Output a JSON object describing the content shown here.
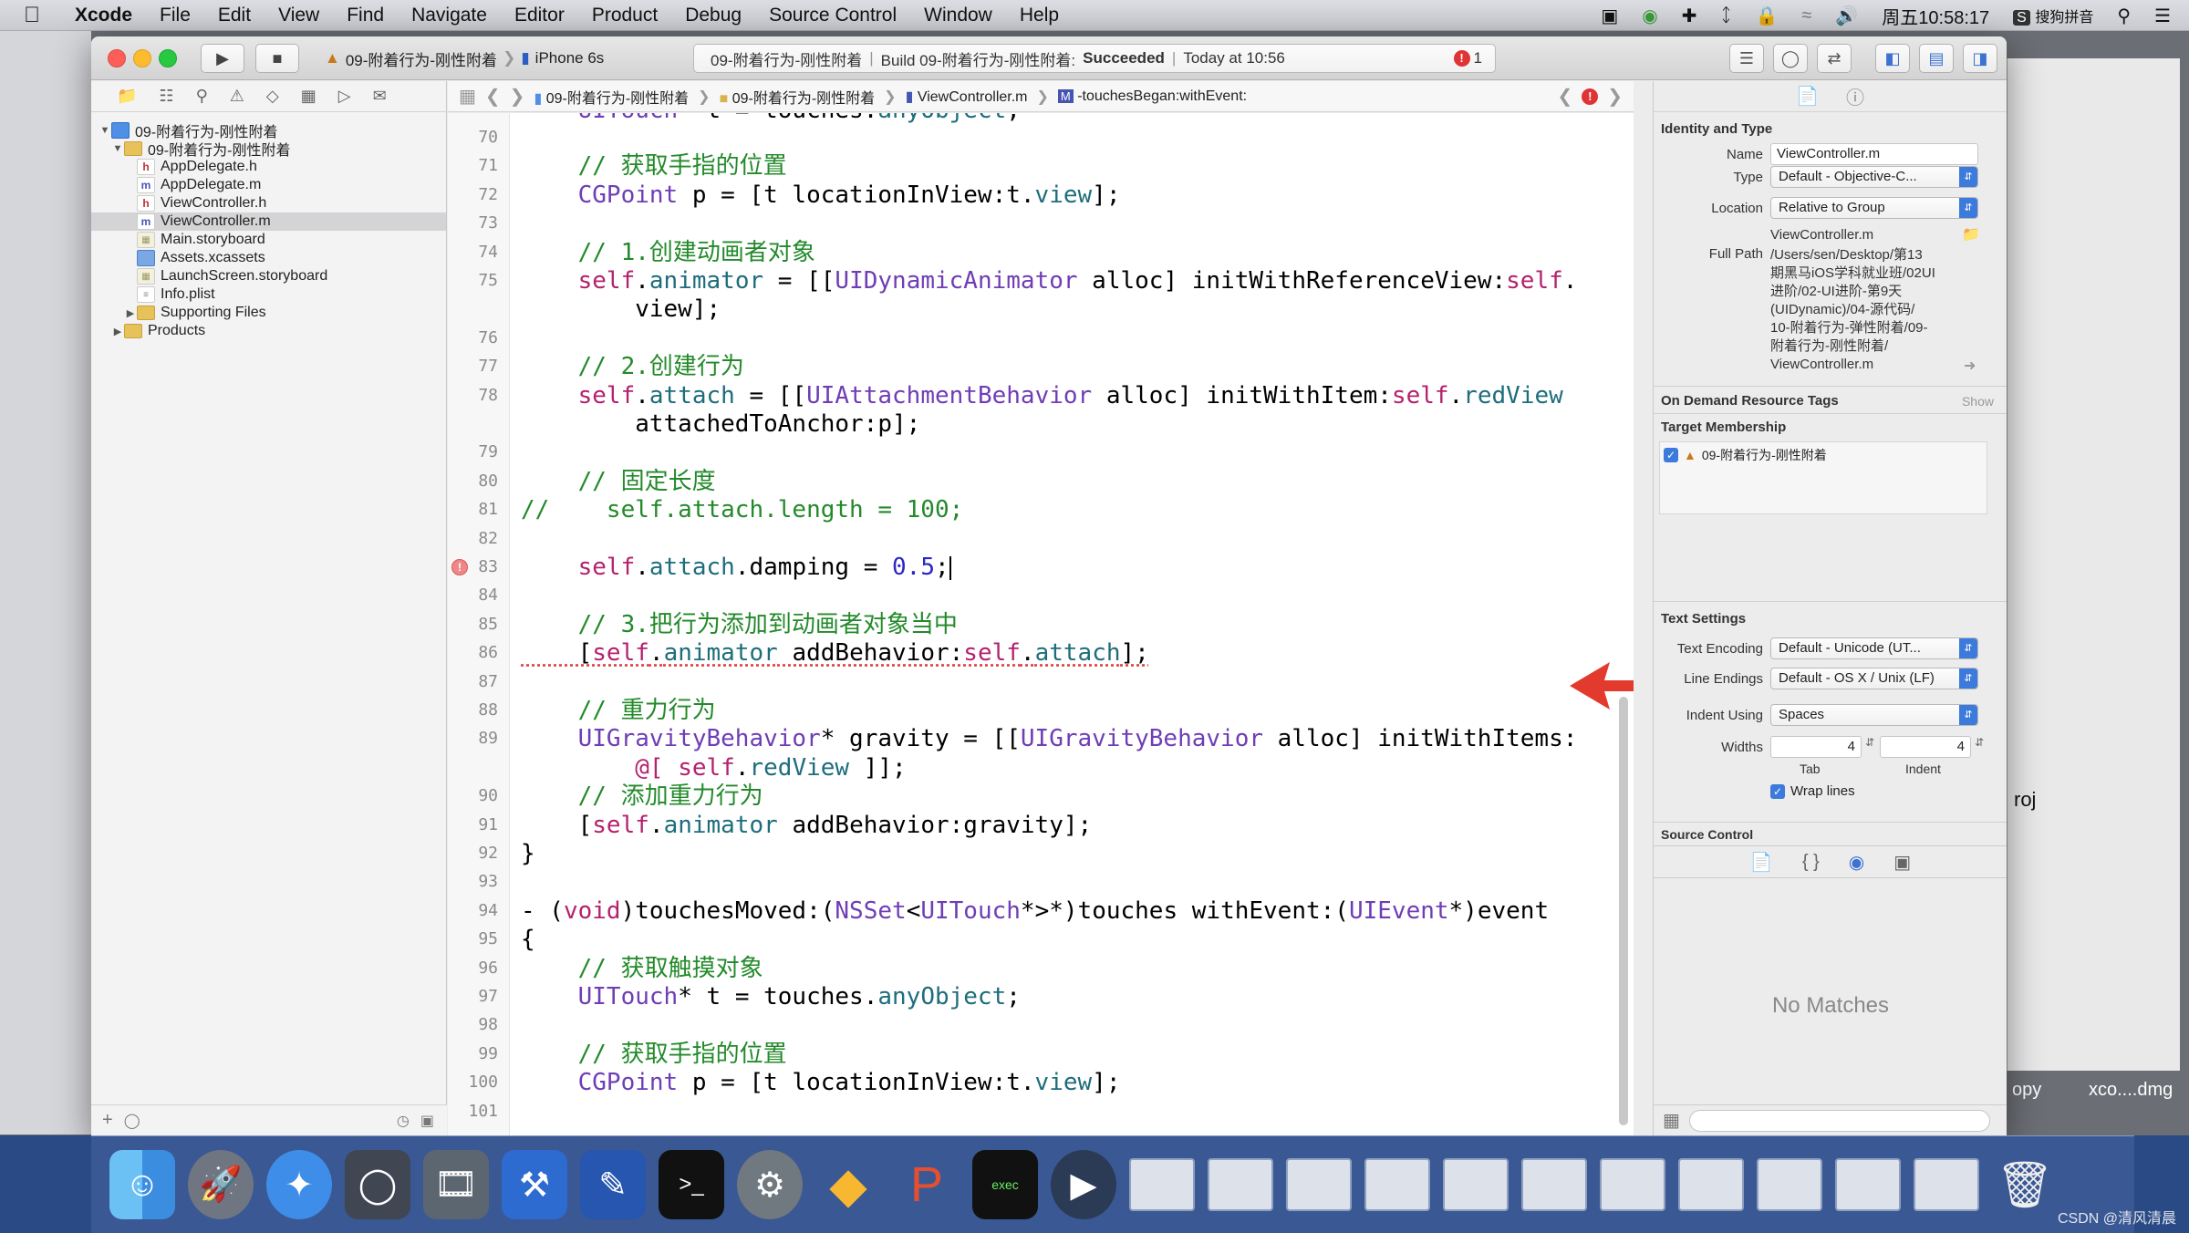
{
  "menubar": {
    "app": "Xcode",
    "items": [
      "File",
      "Edit",
      "View",
      "Find",
      "Navigate",
      "Editor",
      "Product",
      "Debug",
      "Source Control",
      "Window",
      "Help"
    ],
    "clock": "周五10:58:17",
    "input_method": "搜狗拼音"
  },
  "toolbar": {
    "scheme": "09-附着行为-刚性附着",
    "device": "iPhone 6s",
    "status_project": "09-附着行为-刚性附着",
    "status_build": "Build 09-附着行为-刚性附着:",
    "status_result": "Succeeded",
    "status_time": "Today at 10:56",
    "error_count": "1"
  },
  "navigator": {
    "items": [
      {
        "label": "09-附着行为-刚性附着",
        "kind": "proj"
      },
      {
        "label": "09-附着行为-刚性附着",
        "kind": "folder"
      },
      {
        "label": "AppDelegate.h",
        "kind": "h"
      },
      {
        "label": "AppDelegate.m",
        "kind": "m"
      },
      {
        "label": "ViewController.h",
        "kind": "h"
      },
      {
        "label": "ViewController.m",
        "kind": "m"
      },
      {
        "label": "Main.storyboard",
        "kind": "sb"
      },
      {
        "label": "Assets.xcassets",
        "kind": "asset"
      },
      {
        "label": "LaunchScreen.storyboard",
        "kind": "sb"
      },
      {
        "label": "Info.plist",
        "kind": "plist"
      },
      {
        "label": "Supporting Files",
        "kind": "folder"
      },
      {
        "label": "Products",
        "kind": "folder"
      }
    ]
  },
  "jumpbar": {
    "crumbs": [
      "09-附着行为-刚性附着",
      "09-附着行为-刚性附着",
      "ViewController.m",
      "-touchesBegan:withEvent:"
    ]
  },
  "editor": {
    "lines": [
      {
        "n": "70",
        "text": ""
      },
      {
        "n": "71",
        "text": "    // 获取手指的位置"
      },
      {
        "n": "72",
        "text": "    CGPoint p = [t locationInView:t.view];"
      },
      {
        "n": "73",
        "text": ""
      },
      {
        "n": "74",
        "text": "    // 1.创建动画者对象"
      },
      {
        "n": "75",
        "text": "    self.animator = [[UIDynamicAnimator alloc] initWithReferenceView:self."
      },
      {
        "n": "",
        "text": "        view];"
      },
      {
        "n": "76",
        "text": ""
      },
      {
        "n": "77",
        "text": "    // 2.创建行为"
      },
      {
        "n": "78",
        "text": "    self.attach = [[UIAttachmentBehavior alloc] initWithItem:self.redView"
      },
      {
        "n": "",
        "text": "        attachedToAnchor:p];"
      },
      {
        "n": "79",
        "text": ""
      },
      {
        "n": "80",
        "text": "    // 固定长度"
      },
      {
        "n": "81",
        "text": "//    self.attach.length = 100;"
      },
      {
        "n": "82",
        "text": ""
      },
      {
        "n": "83",
        "text": "    self.attach.damping = 0.5;"
      },
      {
        "n": "84",
        "text": ""
      },
      {
        "n": "85",
        "text": "    // 3.把行为添加到动画者对象当中"
      },
      {
        "n": "86",
        "text": "    [self.animator addBehavior:self.attach];"
      },
      {
        "n": "87",
        "text": ""
      },
      {
        "n": "88",
        "text": "    // 重力行为"
      },
      {
        "n": "89",
        "text": "    UIGravityBehavior* gravity = [[UIGravityBehavior alloc] initWithItems:"
      },
      {
        "n": "",
        "text": "        @[ self.redView ]];"
      },
      {
        "n": "90",
        "text": "    // 添加重力行为"
      },
      {
        "n": "91",
        "text": "    [self.animator addBehavior:gravity];"
      },
      {
        "n": "92",
        "text": "}"
      },
      {
        "n": "93",
        "text": ""
      },
      {
        "n": "94",
        "text": "- (void)touchesMoved:(NSSet<UITouch*>*)touches withEvent:(UIEvent*)event"
      },
      {
        "n": "95",
        "text": "{"
      },
      {
        "n": "96",
        "text": "    // 获取触摸对象"
      },
      {
        "n": "97",
        "text": "    UITouch* t = touches.anyObject;"
      },
      {
        "n": "98",
        "text": ""
      },
      {
        "n": "99",
        "text": "    // 获取手指的位置"
      },
      {
        "n": "100",
        "text": "    CGPoint p = [t locationInView:t.view];"
      },
      {
        "n": "101",
        "text": ""
      }
    ],
    "error_line": "83"
  },
  "inspector": {
    "identity_title": "Identity and Type",
    "name_label": "Name",
    "name_value": "ViewController.m",
    "type_label": "Type",
    "type_value": "Default - Objective-C...",
    "location_label": "Location",
    "location_value": "Relative to Group",
    "location_file": "ViewController.m",
    "fullpath_label": "Full Path",
    "fullpath_value": "/Users/sen/Desktop/第13\n期黑马iOS学科就业班/02UI\n进阶/02-UI进阶-第9天\n(UIDynamic)/04-源代码/\n10-附着行为-弹性附着/09-\n附着行为-刚性附着/\nViewController.m",
    "odr_title": "On Demand Resource Tags",
    "odr_show": "Show",
    "target_title": "Target Membership",
    "target_name": "09-附着行为-刚性附着",
    "text_title": "Text Settings",
    "encoding_label": "Text Encoding",
    "encoding_value": "Default - Unicode (UT...",
    "endings_label": "Line Endings",
    "endings_value": "Default - OS X / Unix (LF)",
    "indent_label": "Indent Using",
    "indent_value": "Spaces",
    "widths_label": "Widths",
    "tab_value": "4",
    "indent_num": "4",
    "tab_caption": "Tab",
    "indent_caption": "Indent",
    "wrap_label": "Wrap lines",
    "source_control_title": "Source Control",
    "no_matches": "No Matches"
  },
  "desktop": {
    "label_roj": "roj",
    "label_opy": "opy",
    "label_dmg": "xco....dmg"
  },
  "watermark": "CSDN @清风清晨"
}
